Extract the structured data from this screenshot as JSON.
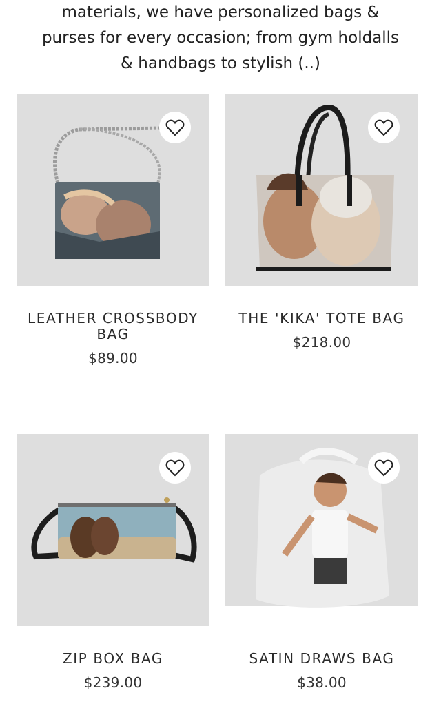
{
  "intro": {
    "line1": "materials, we have personalized bags &",
    "line2": "purses for every occasion; from gym holdalls",
    "line3": "& handbags to stylish (..)"
  },
  "products": [
    {
      "title": "LEATHER CROSSBODY BAG",
      "price": "$89.00",
      "image": "crossbody-bag-photo",
      "favorite_icon": "heart-outline-icon"
    },
    {
      "title": "THE 'KIKA' TOTE BAG",
      "price": "$218.00",
      "image": "tote-bag-photo",
      "favorite_icon": "heart-outline-icon"
    },
    {
      "title": "ZIP BOX BAG",
      "price": "$239.00",
      "image": "zip-box-bag-photo",
      "favorite_icon": "heart-outline-icon"
    },
    {
      "title": "SATIN DRAWS BAG",
      "price": "$38.00",
      "image": "satin-drawstring-bag-photo",
      "favorite_icon": "heart-outline-icon"
    }
  ],
  "colors": {
    "image_background": "#dedede",
    "text": "#2a2a2a"
  }
}
